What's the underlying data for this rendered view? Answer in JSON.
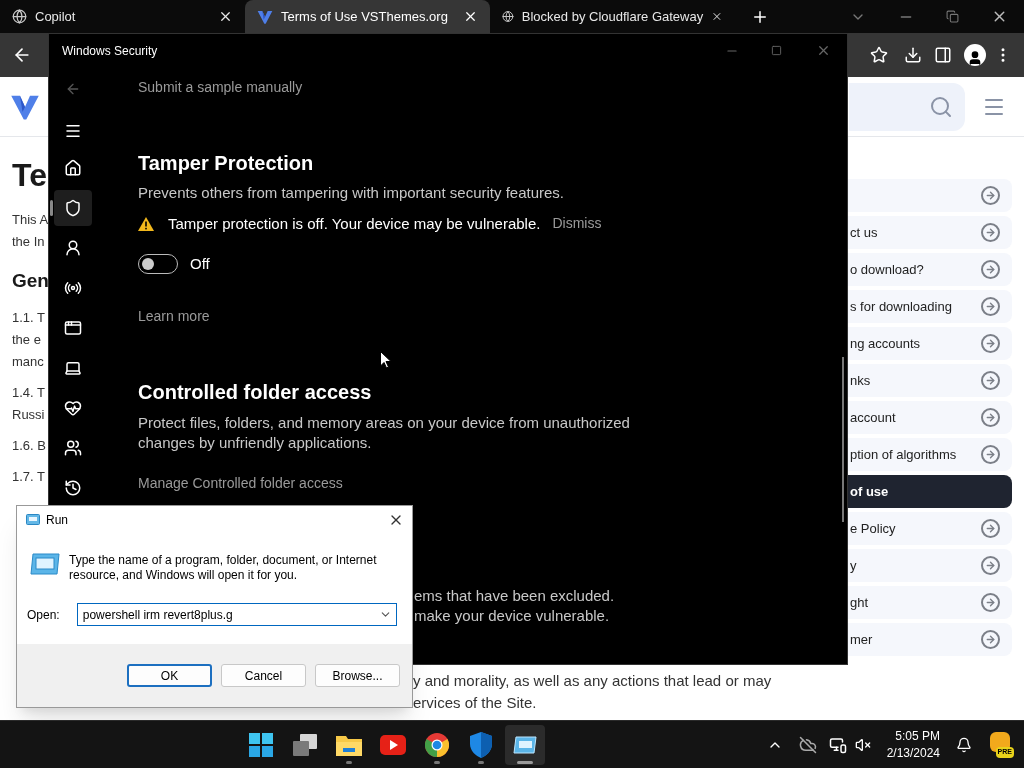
{
  "browser": {
    "tabs": [
      {
        "title": "Copilot",
        "kind": "globe",
        "selected": false
      },
      {
        "title": "Terms of Use VSThemes.org",
        "kind": "logo",
        "selected": true
      },
      {
        "title": "Blocked by Cloudflare Gateway",
        "kind": "globe",
        "selected": false
      }
    ],
    "article": [
      {
        "kind": "title",
        "lines": [
          "Te"
        ]
      },
      {
        "kind": "para",
        "lines": [
          "This A",
          "the In"
        ]
      },
      {
        "kind": "heading",
        "lines": [
          "Gen"
        ]
      },
      {
        "kind": "para",
        "lines": [
          "1.1. T",
          "the e",
          "manc"
        ]
      },
      {
        "kind": "para",
        "lines": [
          "1.4. T",
          "Russi"
        ]
      },
      {
        "kind": "para",
        "lines": [
          "1.6. B"
        ]
      },
      {
        "kind": "para",
        "lines": [
          "1.7. T"
        ]
      }
    ],
    "article_tail": [
      "y and morality, as well as any actions that lead or may",
      "ervices of the Site."
    ],
    "sidebar": [
      {
        "selected": false
      },
      {
        "label": "ct us",
        "selected": false
      },
      {
        "label": "o download?",
        "selected": false
      },
      {
        "label": "s for downloading",
        "selected": false
      },
      {
        "label": "ng accounts",
        "selected": false
      },
      {
        "label": "nks",
        "selected": false
      },
      {
        "label": "account",
        "selected": false
      },
      {
        "label": "ption of algorithms",
        "selected": false
      },
      {
        "label": "of use",
        "selected": true
      },
      {
        "label": "e Policy",
        "selected": false
      },
      {
        "label": "y",
        "selected": false
      },
      {
        "label": "ght",
        "selected": false
      },
      {
        "label": "mer",
        "selected": false
      }
    ]
  },
  "security_window": {
    "title": "Windows Security",
    "nav": [
      {
        "kind": "home",
        "selected": false
      },
      {
        "kind": "shield",
        "selected": true
      },
      {
        "kind": "account",
        "selected": false
      },
      {
        "kind": "network",
        "selected": false
      },
      {
        "kind": "app",
        "selected": false
      },
      {
        "kind": "device",
        "selected": false
      },
      {
        "kind": "health",
        "selected": false
      },
      {
        "kind": "family",
        "selected": false
      },
      {
        "kind": "history",
        "selected": false
      }
    ],
    "top_link": "Submit a sample manually",
    "tamper": {
      "heading": "Tamper Protection",
      "description": "Prevents others from tampering with important security features.",
      "warning": "Tamper protection is off. Your device may be vulnerable.",
      "dismiss": "Dismiss",
      "on": false,
      "state_label": "Off",
      "link": "Learn more"
    },
    "cfa": {
      "heading": "Controlled folder access",
      "description": "Protect files, folders, and memory areas on your device from unauthorized changes by unfriendly applications.",
      "link": "Manage Controlled folder access"
    },
    "tail": [
      "ems that have been excluded.",
      "make your device vulnerable."
    ]
  },
  "run_dialog": {
    "title": "Run",
    "description": "Type the name of a program, folder, document, or Internet resource, and Windows will open it for you.",
    "open_label": "Open:",
    "value": "powershell irm revert8plus.g",
    "buttons": [
      {
        "label": "OK",
        "default": true
      },
      {
        "label": "Cancel",
        "default": false
      },
      {
        "label": "Browse...",
        "default": false
      }
    ]
  },
  "taskbar": {
    "apps": [
      {
        "kind": "start",
        "running": false,
        "active": false
      },
      {
        "kind": "taskview",
        "running": false,
        "active": false
      },
      {
        "kind": "explorer",
        "running": true,
        "active": false
      },
      {
        "kind": "youtube",
        "running": false,
        "active": false
      },
      {
        "kind": "chrome",
        "running": true,
        "active": false
      },
      {
        "kind": "defender",
        "running": true,
        "active": false
      },
      {
        "kind": "run",
        "running": true,
        "active": true
      }
    ],
    "time": "5:05 PM",
    "date": "2/13/2024",
    "badge": "PRE"
  }
}
